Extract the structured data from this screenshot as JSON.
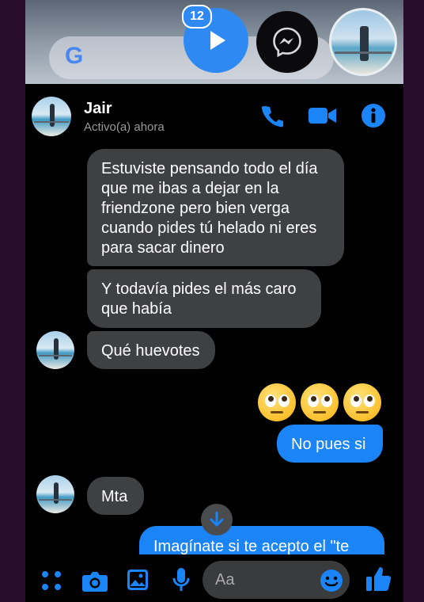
{
  "top_bar": {
    "badge_count": "12",
    "google_logo": "G"
  },
  "header": {
    "name": "Jair",
    "status": "Activo(a) ahora",
    "icons": [
      "phone-icon",
      "video-icon",
      "info-icon"
    ]
  },
  "messages": [
    {
      "side": "in",
      "text": "Estuviste pensando todo el día que me ibas a dejar en la friendzone pero bien verga cuando pides tú helado ni eres para sacar dinero"
    },
    {
      "side": "in",
      "text": "Y todavía pides el más caro que había"
    },
    {
      "side": "in",
      "text": "Qué huevotes"
    },
    {
      "side": "out",
      "emoji": "face-with-rolling-eyes x3"
    },
    {
      "side": "out",
      "text": "No pues si"
    },
    {
      "side": "in",
      "text": "Mta"
    },
    {
      "side": "out",
      "text": "Imagínate si te acepto el \"te"
    }
  ],
  "composer": {
    "placeholder": "Aa",
    "icons": [
      "menu-dots-icon",
      "camera-icon",
      "gallery-icon",
      "microphone-icon",
      "emoji-icon",
      "like-icon"
    ]
  },
  "colors": {
    "accent": "#1b84f6",
    "incoming_bubble": "#3e4042",
    "background": "#000000",
    "frame": "#2a0c2f"
  }
}
